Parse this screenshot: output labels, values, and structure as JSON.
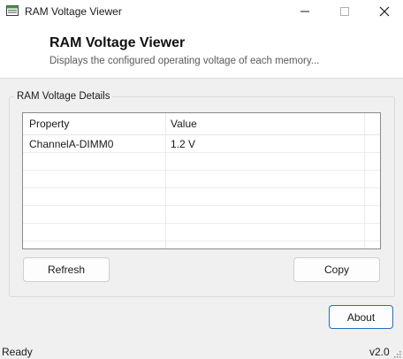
{
  "window": {
    "title": "RAM Voltage Viewer",
    "controls": {
      "minimize": "minimize-icon",
      "maximize": "maximize-icon",
      "close": "close-icon"
    }
  },
  "header": {
    "title": "RAM Voltage Viewer",
    "subtitle": "Displays the configured operating voltage of each memory..."
  },
  "group": {
    "label": "RAM Voltage Details",
    "table": {
      "columns": [
        "Property",
        "Value"
      ],
      "rows": [
        {
          "property": "ChannelA-DIMM0",
          "value": "1.2 V"
        }
      ]
    }
  },
  "buttons": {
    "refresh": "Refresh",
    "copy": "Copy",
    "about": "About"
  },
  "status": {
    "text": "Ready",
    "version": "v2.0"
  },
  "colors": {
    "accent": "#1f6fc4",
    "background": "#f0f0f0",
    "panel": "#ffffff"
  }
}
